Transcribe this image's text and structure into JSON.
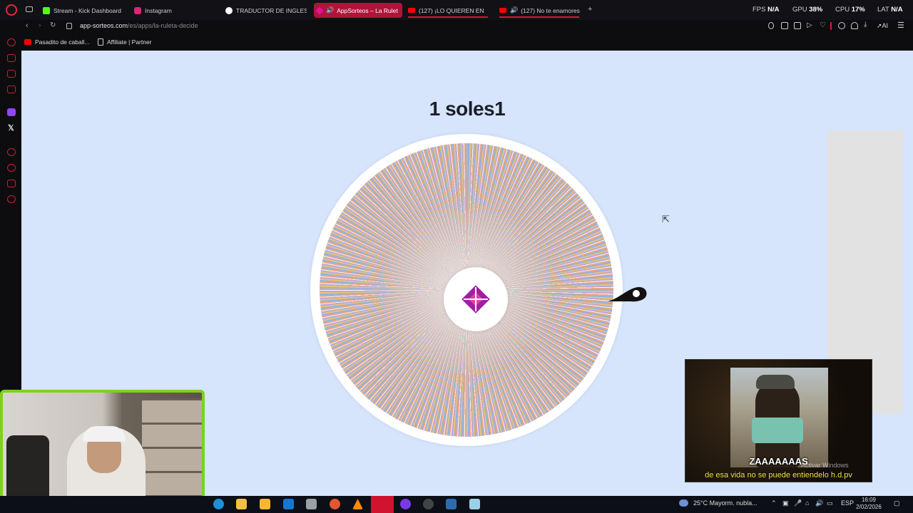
{
  "browser": {
    "tabs": [
      {
        "label": "Stream - Kick Dashboard",
        "icon": "kick-icon",
        "color": "#53fc18"
      },
      {
        "label": "Instagram",
        "icon": "instagram-icon",
        "color": "#d62976"
      },
      {
        "label": "TRADUCTOR DE INGLES A",
        "icon": "google-icon",
        "color": "#4285f4"
      },
      {
        "label": "AppSorteos – La Rulet",
        "icon": "appsorteos-icon",
        "color": "#b6279f",
        "active": true
      },
      {
        "label": "(127) ¡LO QUIEREN EN",
        "icon": "youtube-icon",
        "color": "#ff0000"
      },
      {
        "label": "(127) No te enamores",
        "icon": "youtube-icon",
        "color": "#ff0000"
      }
    ],
    "new_tab": "+",
    "stats": {
      "fps_label": "FPS",
      "fps_value": "N/A",
      "gpu_label": "GPU",
      "gpu_value": "38%",
      "cpu_label": "CPU",
      "cpu_value": "17%",
      "lat_label": "LAT",
      "lat_value": "N/A"
    },
    "url_domain": "app-sorteos.com",
    "url_path": "/es/apps/la-ruleta-decide",
    "ai_label": "AI",
    "bookmarks": [
      {
        "label": "Pasadito de caball...",
        "icon": "youtube-icon"
      },
      {
        "label": "Affiliate | Partner",
        "icon": "page-icon"
      }
    ]
  },
  "page": {
    "title": "1 soles1",
    "accent": "#b6279f"
  },
  "overlay": {
    "shout": "ZAAAAAAAS",
    "subtitle": "de esa vida no se puede entiendelo h.d.pv",
    "watermark": "Activar Windows"
  },
  "taskbar": {
    "weather": "25°C  Mayorm. nubla...",
    "lang": "ESP",
    "time": "16:09",
    "date": "2/02/2026"
  }
}
